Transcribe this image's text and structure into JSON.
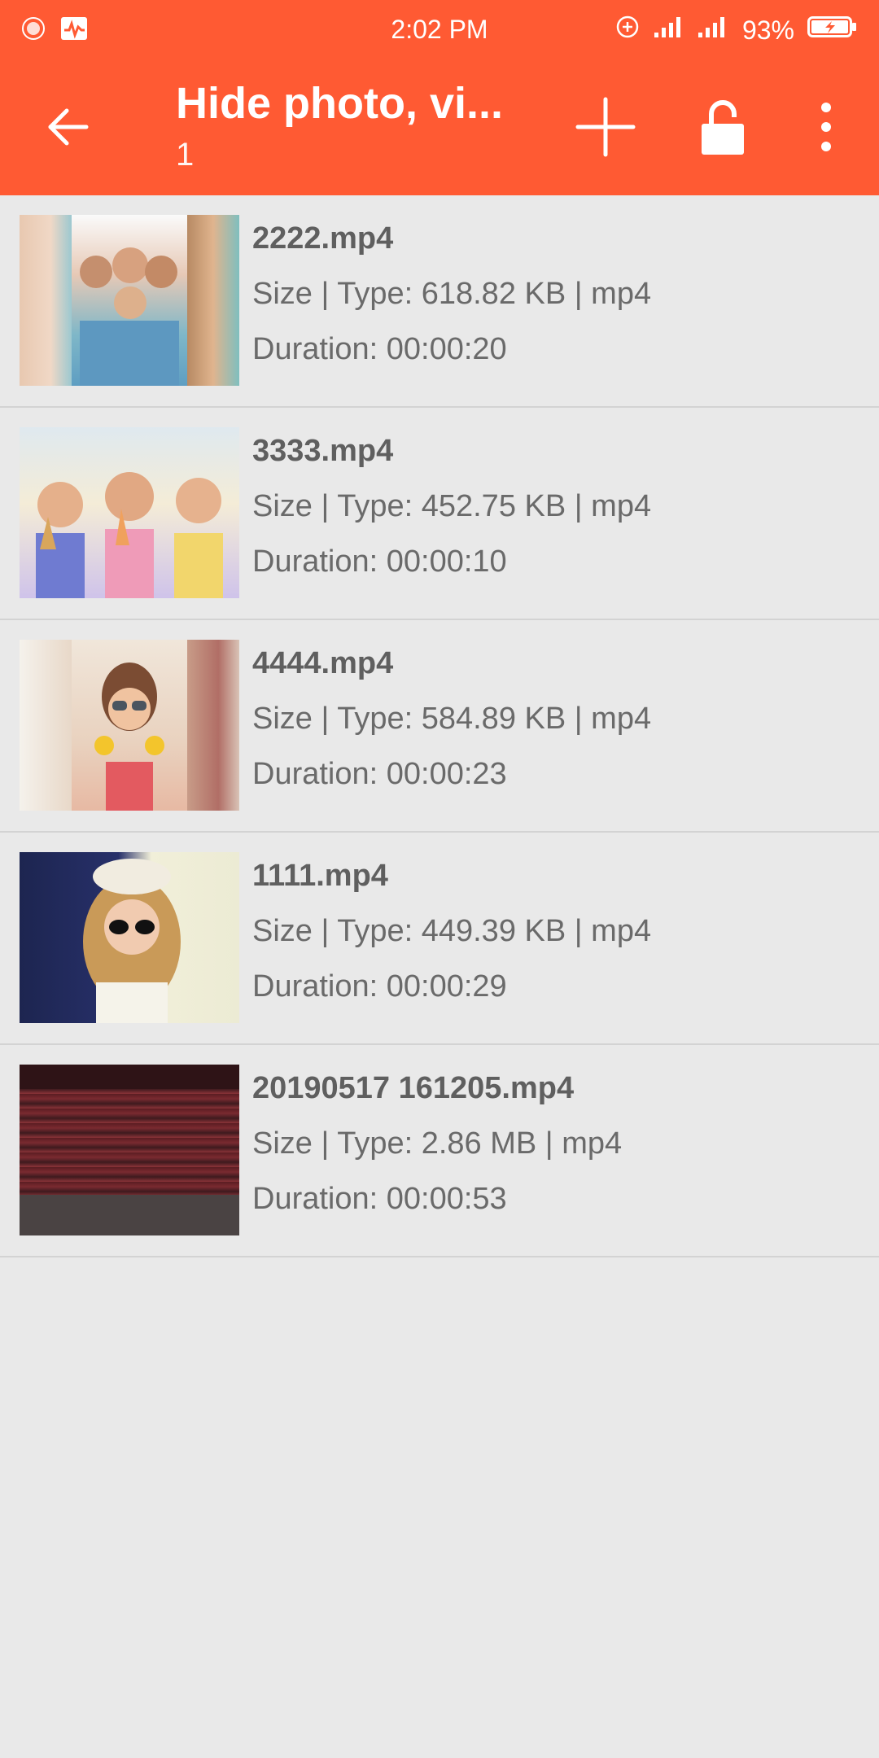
{
  "status_bar": {
    "time": "2:02 PM",
    "battery_percent": "93%",
    "icons": [
      "notification-dot-icon",
      "activity-icon",
      "data-saver-icon",
      "signal-icon",
      "signal-icon",
      "battery-charging-icon"
    ]
  },
  "app_bar": {
    "title": "Hide photo, vi...",
    "subtitle": "1",
    "icons": [
      "back-arrow-icon",
      "plus-icon",
      "unlock-icon",
      "more-vert-icon"
    ]
  },
  "colors": {
    "accent": "#ff5a33",
    "background": "#e9e9e9",
    "text": "#666666"
  },
  "files": [
    {
      "name": "2222.mp4",
      "size_type": "Size | Type: 618.82 KB | mp4",
      "duration": "Duration: 00:00:20"
    },
    {
      "name": "3333.mp4",
      "size_type": "Size | Type: 452.75 KB | mp4",
      "duration": "Duration: 00:00:10"
    },
    {
      "name": "4444.mp4",
      "size_type": "Size | Type: 584.89 KB | mp4",
      "duration": "Duration: 00:00:23"
    },
    {
      "name": "1111.mp4",
      "size_type": "Size | Type: 449.39 KB | mp4",
      "duration": "Duration: 00:00:29"
    },
    {
      "name": "20190517 161205.mp4",
      "size_type": "Size | Type: 2.86 MB | mp4",
      "duration": "Duration: 00:00:53"
    }
  ]
}
